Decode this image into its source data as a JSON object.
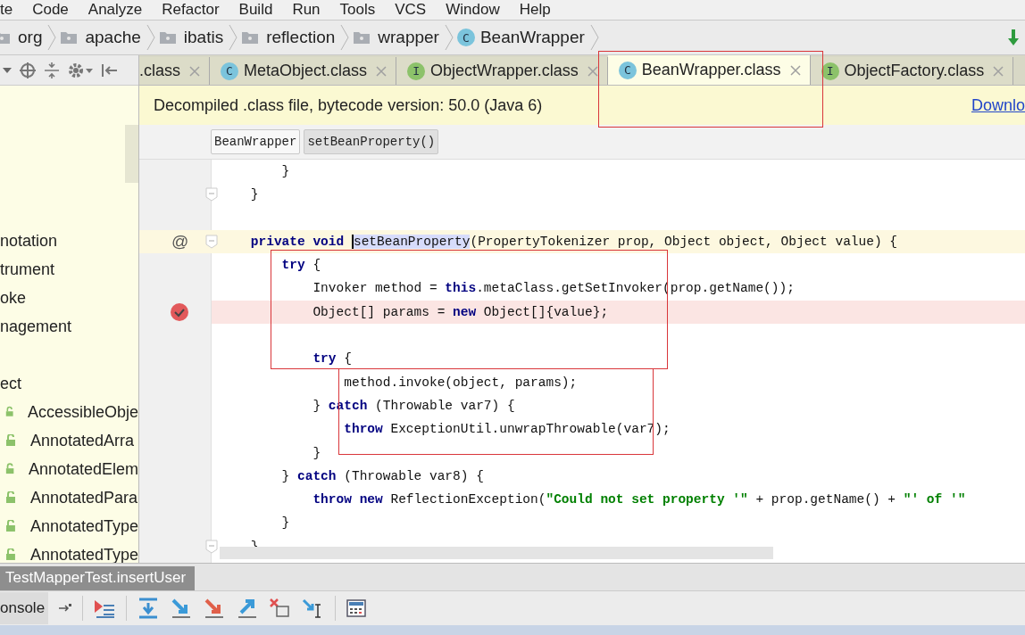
{
  "menu": [
    "te",
    "Code",
    "Analyze",
    "Refactor",
    "Build",
    "Run",
    "Tools",
    "VCS",
    "Window",
    "Help"
  ],
  "breadcrumbs": [
    {
      "label": "org",
      "kind": "folder"
    },
    {
      "label": "apache",
      "kind": "folder"
    },
    {
      "label": "ibatis",
      "kind": "folder"
    },
    {
      "label": "reflection",
      "kind": "folder"
    },
    {
      "label": "wrapper",
      "kind": "folder"
    },
    {
      "label": "BeanWrapper",
      "kind": "class",
      "badge": "C"
    }
  ],
  "project_tree": [
    {
      "label": "notation"
    },
    {
      "label": "trument"
    },
    {
      "label": "oke"
    },
    {
      "label": "nagement"
    },
    {
      "label": "ect",
      "children": [
        {
          "label": "AccessibleObje"
        },
        {
          "label": "AnnotatedArra"
        },
        {
          "label": "AnnotatedElem"
        },
        {
          "label": "AnnotatedPara"
        },
        {
          "label": "AnnotatedType"
        },
        {
          "label": "AnnotatedType"
        }
      ]
    }
  ],
  "tabs": [
    {
      "label": ".class",
      "kind": "none",
      "selected": false
    },
    {
      "label": "MetaObject.class",
      "kind": "class",
      "badge": "C",
      "selected": false
    },
    {
      "label": "ObjectWrapper.class",
      "kind": "interface",
      "badge": "I",
      "selected": false
    },
    {
      "label": "BeanWrapper.class",
      "kind": "class",
      "badge": "C",
      "selected": true
    },
    {
      "label": "ObjectFactory.class",
      "kind": "interface",
      "badge": "I",
      "selected": false
    }
  ],
  "banner": {
    "text": "Decompiled .class file, bytecode version: 50.0 (Java 6)",
    "link": "Downlo"
  },
  "code_breadcrumbs": [
    "BeanWrapper",
    "setBeanProperty()"
  ],
  "code_lines": [
    {
      "tokens": [
        {
          "text": "        }",
          "kind": "plain"
        }
      ]
    },
    {
      "fold": true,
      "tokens": [
        {
          "text": "    }",
          "kind": "plain"
        }
      ]
    },
    {
      "blank_line_above": true,
      "caret_line": true,
      "gutter": "@",
      "fold": true,
      "tokens": [
        {
          "text": "    private void ",
          "kind": "keyword"
        },
        {
          "text": "setBeanProperty",
          "kind": "selected"
        },
        {
          "text": "(PropertyTokenizer prop, Object object, Object value) {",
          "kind": "plain"
        }
      ]
    },
    {
      "tokens": [
        {
          "text": "        try",
          "kind": "keyword"
        },
        {
          "text": " {",
          "kind": "plain"
        }
      ]
    },
    {
      "tokens": [
        {
          "text": "            Invoker method = ",
          "kind": "plain"
        },
        {
          "text": "this",
          "kind": "keyword"
        },
        {
          "text": ".metaClass.getSetInvoker(prop.getName());",
          "kind": "plain"
        }
      ]
    },
    {
      "breakpoint": true,
      "tokens": [
        {
          "text": "            Object[] params = ",
          "kind": "plain"
        },
        {
          "text": "new",
          "kind": "keyword"
        },
        {
          "text": " Object[]{value};",
          "kind": "plain"
        }
      ]
    },
    {
      "blank_line_above": true,
      "tokens": [
        {
          "text": "            try",
          "kind": "keyword"
        },
        {
          "text": " {",
          "kind": "plain"
        }
      ]
    },
    {
      "tokens": [
        {
          "text": "                method.invoke(object, params);",
          "kind": "plain"
        }
      ]
    },
    {
      "tokens": [
        {
          "text": "            } ",
          "kind": "plain"
        },
        {
          "text": "catch",
          "kind": "keyword"
        },
        {
          "text": " (Throwable var7) {",
          "kind": "plain"
        }
      ]
    },
    {
      "tokens": [
        {
          "text": "                throw",
          "kind": "keyword"
        },
        {
          "text": " ExceptionUtil.unwrapThrowable(var7);",
          "kind": "plain"
        }
      ]
    },
    {
      "tokens": [
        {
          "text": "            }",
          "kind": "plain"
        }
      ]
    },
    {
      "tokens": [
        {
          "text": "        } ",
          "kind": "plain"
        },
        {
          "text": "catch",
          "kind": "keyword"
        },
        {
          "text": " (Throwable var8) {",
          "kind": "plain"
        }
      ]
    },
    {
      "tokens": [
        {
          "text": "            throw new",
          "kind": "keyword"
        },
        {
          "text": " ReflectionException(",
          "kind": "plain"
        },
        {
          "text": "\"Could not set property '\"",
          "kind": "string"
        },
        {
          "text": " + prop.getName() + ",
          "kind": "plain"
        },
        {
          "text": "\"' of '\"",
          "kind": "string"
        }
      ]
    },
    {
      "tokens": [
        {
          "text": "        }",
          "kind": "plain"
        }
      ]
    },
    {
      "fold": true,
      "tokens": [
        {
          "text": "    }",
          "kind": "plain"
        }
      ]
    }
  ],
  "debug": {
    "tab": "TestMapperTest.insertUser",
    "console": "onsole"
  }
}
